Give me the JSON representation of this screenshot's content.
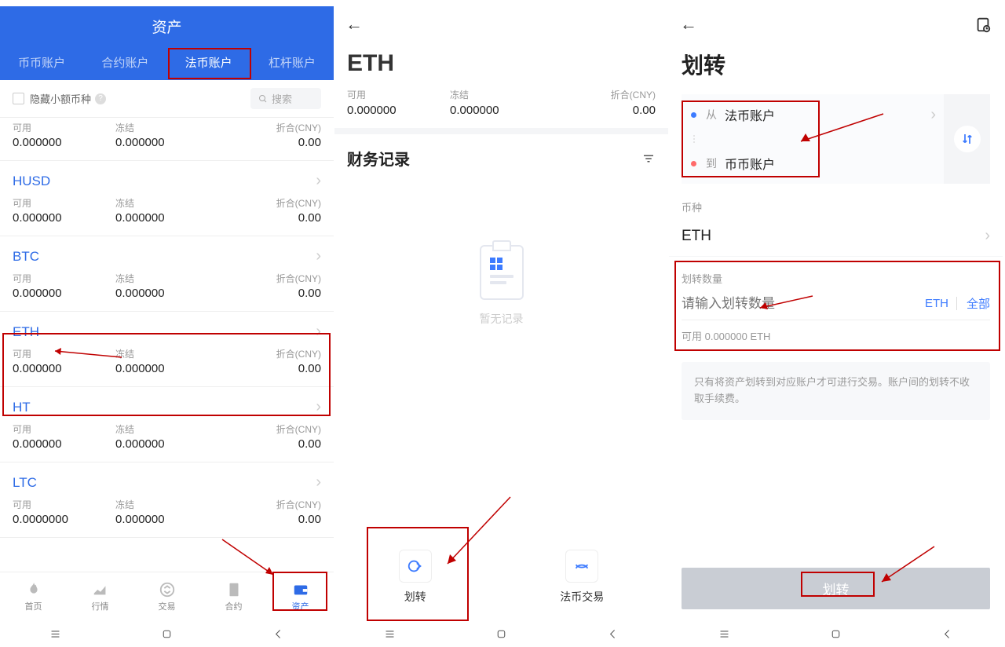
{
  "phone1": {
    "title": "资产",
    "tabs": [
      "币币账户",
      "合约账户",
      "法币账户",
      "杠杆账户"
    ],
    "active_tab_index": 2,
    "hide_small_label": "隐藏小额币种",
    "search_placeholder": "搜索",
    "cols": {
      "avail": "可用",
      "frozen": "冻结",
      "cny": "折合(CNY)"
    },
    "top_row": {
      "avail": "0.000000",
      "frozen": "0.000000",
      "cny": "0.00"
    },
    "coins": [
      {
        "name": "HUSD",
        "avail": "0.000000",
        "frozen": "0.000000",
        "cny": "0.00"
      },
      {
        "name": "BTC",
        "avail": "0.000000",
        "frozen": "0.000000",
        "cny": "0.00"
      },
      {
        "name": "ETH",
        "avail": "0.000000",
        "frozen": "0.000000",
        "cny": "0.00"
      },
      {
        "name": "HT",
        "avail": "0.000000",
        "frozen": "0.000000",
        "cny": "0.00"
      },
      {
        "name": "LTC",
        "avail": "0.0000000",
        "frozen": "0.000000",
        "cny": "0.00"
      }
    ],
    "nav": [
      "首页",
      "行情",
      "交易",
      "合约",
      "资产"
    ],
    "nav_active_index": 4
  },
  "phone2": {
    "title": "ETH",
    "cols": {
      "avail": "可用",
      "frozen": "冻结",
      "cny": "折合(CNY)"
    },
    "balance": {
      "avail": "0.000000",
      "frozen": "0.000000",
      "cny": "0.00"
    },
    "section_title": "财务记录",
    "empty_text": "暂无记录",
    "action_transfer": "划转",
    "action_fiat": "法币交易"
  },
  "phone3": {
    "title": "划转",
    "from_label": "从",
    "from_val": "法币账户",
    "to_label": "到",
    "to_val": "币币账户",
    "currency_label": "币种",
    "currency_val": "ETH",
    "amount_label": "划转数量",
    "amount_placeholder": "请输入划转数量",
    "amount_unit": "ETH",
    "amount_all": "全部",
    "available_text": "可用 0.000000 ETH",
    "note_text": "只有将资产划转到对应账户才可进行交易。账户间的划转不收取手续费。",
    "submit_label": "划转"
  }
}
